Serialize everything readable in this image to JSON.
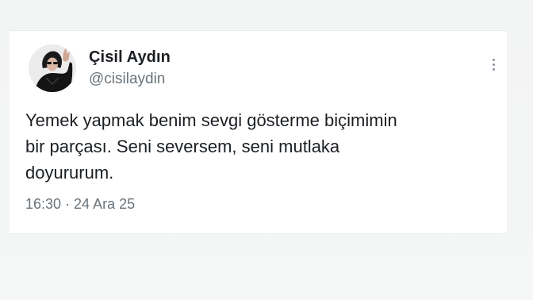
{
  "tweet": {
    "author": {
      "display_name": "Çisil Aydın",
      "handle": "@cisilaydin",
      "avatar_icon": "profile-photo"
    },
    "text_lines": [
      "Yemek yapmak benim sevgi gösterme biçimimin",
      "bir parçası. Seni seversem, seni mutlaka",
      "doyururum."
    ],
    "time": "16:30",
    "separator": "·",
    "date": "24 Ara 25",
    "more_icon": "more-vertical-icon"
  },
  "colors": {
    "background": "#f4f5f5",
    "card": "#ffffff",
    "text_primary": "#1b1f23",
    "text_secondary": "#6a737b"
  }
}
